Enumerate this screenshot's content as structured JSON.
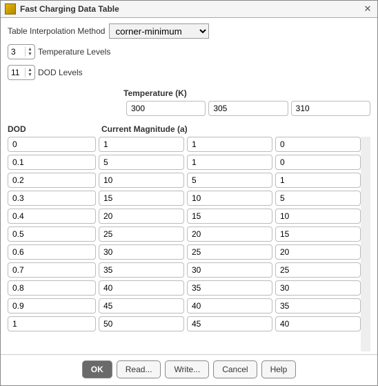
{
  "window": {
    "title": "Fast Charging Data Table"
  },
  "interp": {
    "label": "Table Interpolation Method",
    "value": "corner-minimum"
  },
  "temp_levels": {
    "value": "3",
    "label": "Temperature Levels"
  },
  "dod_levels": {
    "value": "11",
    "label": "DOD Levels"
  },
  "headers": {
    "temperature": "Temperature (K)",
    "dod": "DOD",
    "current": "Current Magnitude (a)"
  },
  "temperatures": [
    "300",
    "305",
    "310"
  ],
  "rows": [
    {
      "dod": "0",
      "vals": [
        "1",
        "1",
        "0"
      ]
    },
    {
      "dod": "0.1",
      "vals": [
        "5",
        "1",
        "0"
      ]
    },
    {
      "dod": "0.2",
      "vals": [
        "10",
        "5",
        "1"
      ]
    },
    {
      "dod": "0.3",
      "vals": [
        "15",
        "10",
        "5"
      ]
    },
    {
      "dod": "0.4",
      "vals": [
        "20",
        "15",
        "10"
      ]
    },
    {
      "dod": "0.5",
      "vals": [
        "25",
        "20",
        "15"
      ]
    },
    {
      "dod": "0.6",
      "vals": [
        "30",
        "25",
        "20"
      ]
    },
    {
      "dod": "0.7",
      "vals": [
        "35",
        "30",
        "25"
      ]
    },
    {
      "dod": "0.8",
      "vals": [
        "40",
        "35",
        "30"
      ]
    },
    {
      "dod": "0.9",
      "vals": [
        "45",
        "40",
        "35"
      ]
    },
    {
      "dod": "1",
      "vals": [
        "50",
        "45",
        "40"
      ]
    }
  ],
  "buttons": {
    "ok": "OK",
    "read": "Read...",
    "write": "Write...",
    "cancel": "Cancel",
    "help": "Help"
  }
}
